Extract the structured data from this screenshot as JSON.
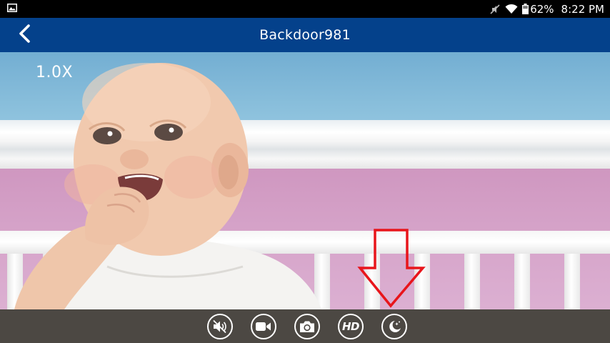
{
  "status_bar": {
    "battery": "62%",
    "time": "8:22 PM",
    "icons": [
      "gallery-notification-icon",
      "mute-icon",
      "wifi-icon",
      "battery-icon"
    ]
  },
  "app_bar": {
    "title": "Backdoor981",
    "back_icon": "chevron-left-icon"
  },
  "video": {
    "zoom": "1.0X"
  },
  "toolbar": {
    "buttons": [
      {
        "name": "speaker-muted",
        "icon": "speaker-muted-icon"
      },
      {
        "name": "record",
        "icon": "video-camera-icon"
      },
      {
        "name": "snapshot",
        "icon": "camera-icon"
      },
      {
        "name": "hd",
        "label": "HD"
      },
      {
        "name": "night-mode",
        "icon": "moon-icon"
      }
    ]
  },
  "colors": {
    "app_bar": "#04418b",
    "toolbar": "#4c4843",
    "annotation": "#e8151b"
  }
}
